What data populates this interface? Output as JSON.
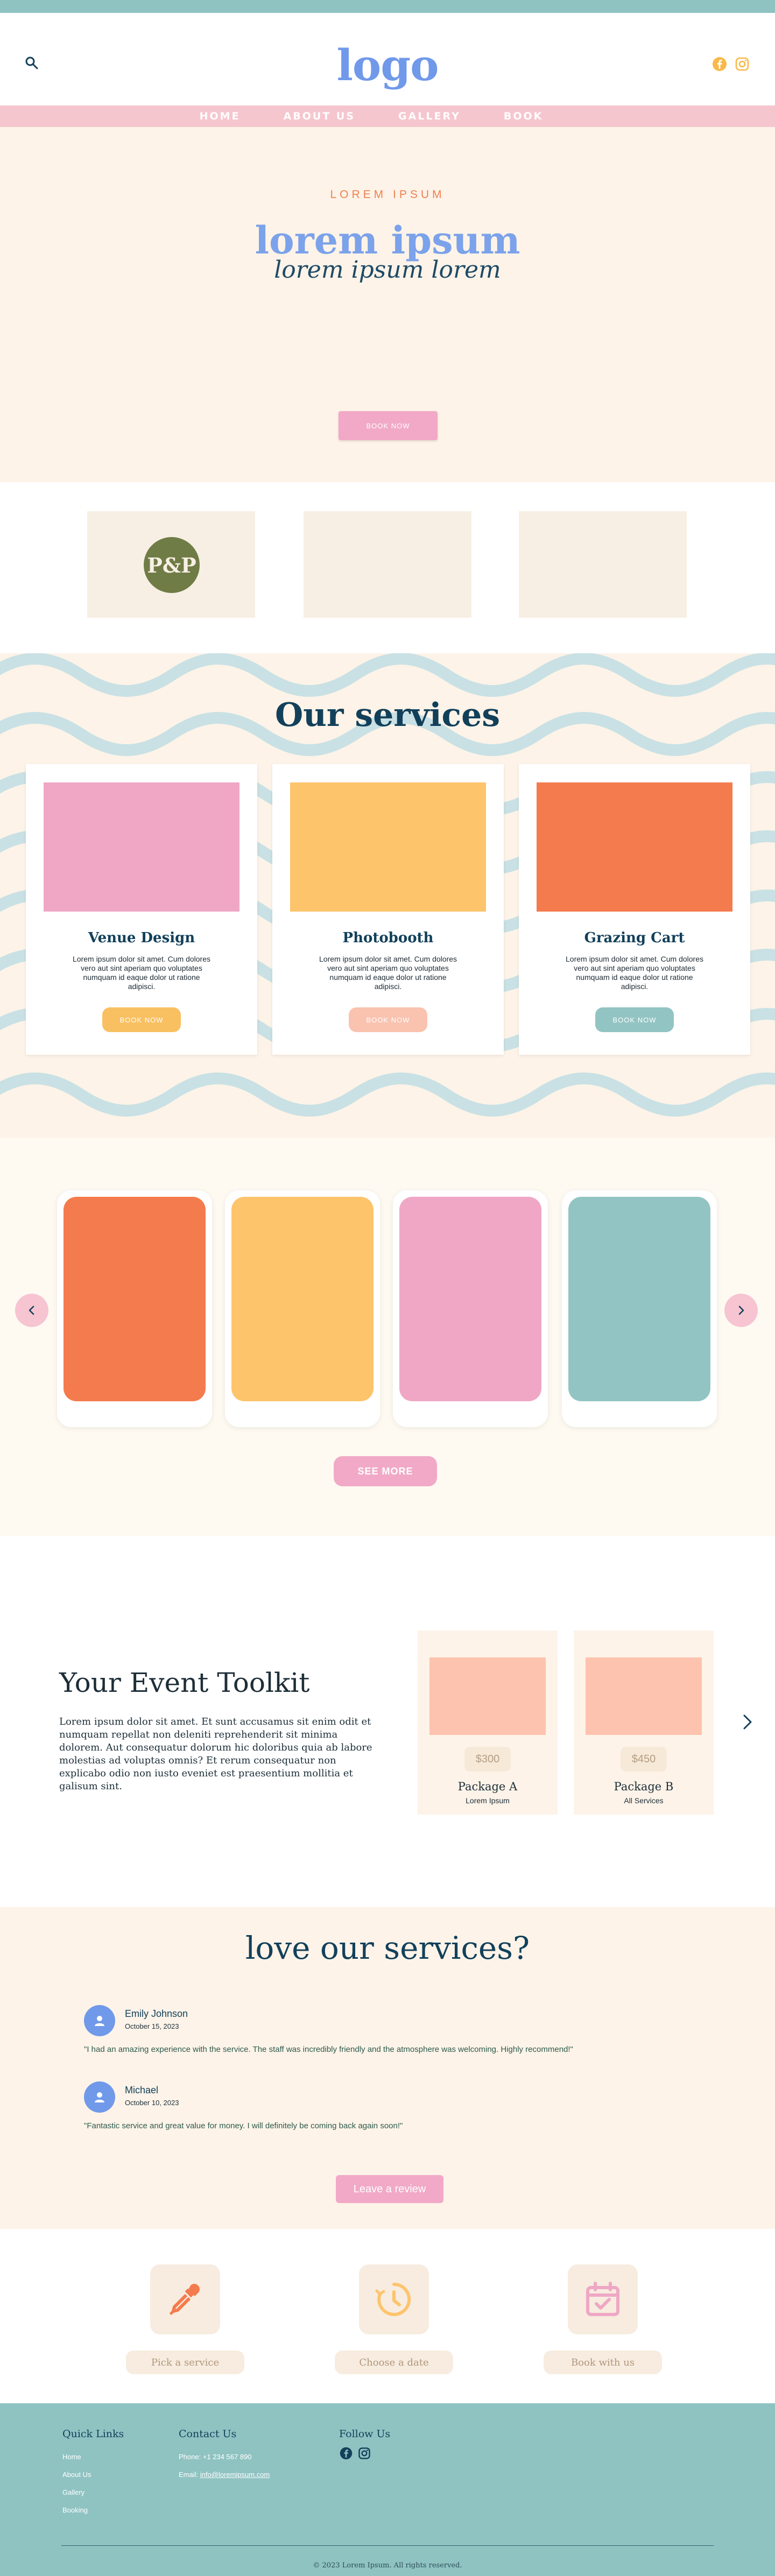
{
  "header": {
    "logo": "logo",
    "nav": [
      "HOME",
      "ABOUT US",
      "GALLERY",
      "BOOK"
    ]
  },
  "hero": {
    "eyebrow": "LOREM IPSUM",
    "title": "lorem ipsum",
    "script": "lorem ipsum lorem",
    "button": "BOOK NOW"
  },
  "partners": {
    "badge_text": "P&P"
  },
  "services": {
    "heading": "Our services",
    "cards": [
      {
        "title": "Venue Design",
        "text": "Lorem ipsum dolor sit amet. Cum dolores vero aut sint aperiam quo voluptates numquam id eaque dolor ut ratione adipisci.",
        "button": "BOOK NOW",
        "image_color": "#efa7c5",
        "button_color": "#f9c061"
      },
      {
        "title": "Photobooth",
        "text": "Lorem ipsum dolor sit amet. Cum dolores vero aut sint aperiam quo voluptates numquam id eaque dolor ut ratione adipisci.",
        "button": "BOOK NOW",
        "image_color": "#fdc46c",
        "button_color": "#f9c3b0"
      },
      {
        "title": "Grazing Cart",
        "text": "Lorem ipsum dolor sit amet. Cum dolores vero aut sint aperiam quo voluptates numquam id eaque dolor ut ratione adipisci.",
        "button": "BOOK NOW",
        "image_color": "#f47b4d",
        "button_color": "#92c4c3"
      }
    ]
  },
  "gallery": {
    "colors": [
      "#f47b4d",
      "#fdc46c",
      "#efa7c5",
      "#92c4c3"
    ],
    "button": "SEE MORE"
  },
  "toolkit": {
    "heading": "Your Event Toolkit",
    "text": "Lorem ipsum dolor sit amet. Et sunt accusamus sit enim odit et numquam repellat non deleniti reprehenderit sit minima dolorem. Aut consequatur dolorum hic doloribus quia ab labore molestias ad voluptas omnis? Et rerum consequatur non explicabo odio non iusto eveniet est praesentium mollitia et galisum sint.",
    "packages": [
      {
        "price": "$300",
        "name": "Package A",
        "sub": "Lorem Ipsum"
      },
      {
        "price": "$450",
        "name": "Package B",
        "sub": "All Services"
      }
    ]
  },
  "reviews": {
    "heading": "love our services?",
    "items": [
      {
        "name": "Emily Johnson",
        "date": "October 15, 2023",
        "text": "\"I had an amazing experience with the service. The staff was incredibly friendly and the atmosphere was welcoming. Highly recommend!\""
      },
      {
        "name": "Michael",
        "date": "October 10, 2023",
        "text": "\"Fantastic service and great value for money. I will definitely be coming back again soon!\""
      }
    ],
    "button": "Leave a review"
  },
  "steps": [
    "Pick a service",
    "Choose a date",
    "Book with us"
  ],
  "footer": {
    "quick_links_title": "Quick Links",
    "quick_links": [
      "Home",
      "About Us",
      "Gallery",
      "Booking"
    ],
    "contact_title": "Contact Us",
    "phone": "Phone: +1 234 567 890",
    "email_label": "Email:",
    "email": "info@loremipsum.com",
    "follow_title": "Follow Us",
    "copyright": "© 2023 Lorem Ipsum. All rights reserved."
  }
}
